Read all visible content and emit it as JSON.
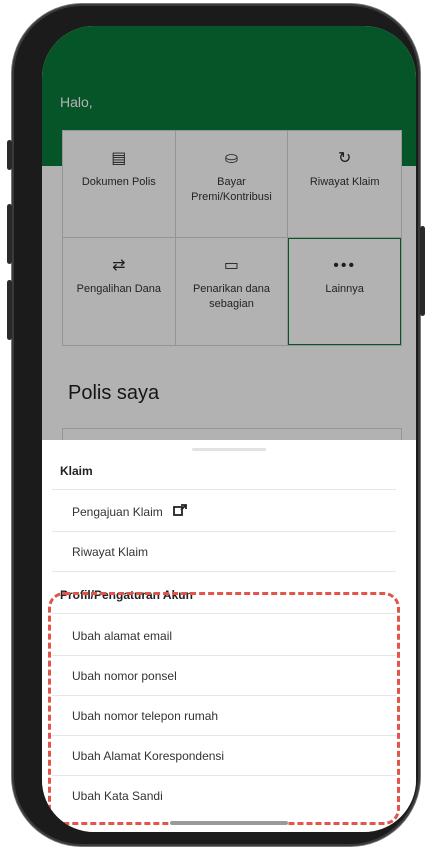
{
  "greeting": "Halo,",
  "menu_grid": [
    {
      "icon": "document-icon",
      "glyph": "▤",
      "label": "Dokumen Polis"
    },
    {
      "icon": "pay-premium-icon",
      "glyph": "⛀",
      "label": "Bayar Premi/Kontribusi"
    },
    {
      "icon": "claim-history-icon",
      "glyph": "↻",
      "label": "Riwayat Klaim"
    },
    {
      "icon": "fund-switch-icon",
      "glyph": "⇄",
      "label": "Pengalihan Dana"
    },
    {
      "icon": "partial-withdrawal-icon",
      "glyph": "▭",
      "label": "Penarikan dana sebagian"
    },
    {
      "icon": "more-icon",
      "glyph": "•••",
      "label": "Lainnya"
    }
  ],
  "section_title": "Polis saya",
  "sheet": {
    "claim_header": "Klaim",
    "claim_items": [
      "Pengajuan Klaim",
      "Riwayat Klaim"
    ],
    "profile_header": "Profil/Pengaturan Akun",
    "profile_items": [
      "Ubah alamat email",
      "Ubah nomor ponsel",
      "Ubah nomor telepon rumah",
      "Ubah Alamat Korespondensi",
      "Ubah Kata Sandi"
    ]
  },
  "colors": {
    "brand_green": "#0a7a3c",
    "highlight_red": "#e0564b"
  }
}
